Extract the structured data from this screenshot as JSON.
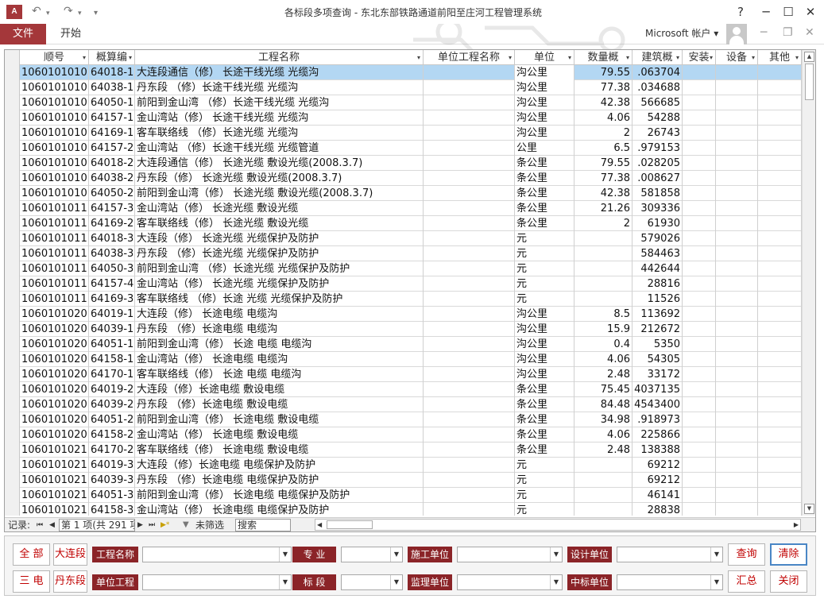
{
  "window": {
    "title": "各标段多项查询 - 东北东部铁路通道前阳至庄河工程管理系统",
    "app_icon": "A",
    "undo": "↶",
    "redo": "↷",
    "qat_more": "▾",
    "help": "?",
    "minimize": "─",
    "maximize": "☐",
    "close": "✕"
  },
  "ribbon": {
    "file_tab": "文件",
    "home_tab": "开始",
    "account": "Microsoft 帐户",
    "account_arrow": "▾",
    "min": "─",
    "restore": "❐",
    "close": "✕"
  },
  "grid": {
    "headers": [
      "顺号",
      "概算编",
      "工程名称",
      "单位工程名称",
      "单位",
      "数量概",
      "建筑概",
      "安装",
      "设备",
      "其他"
    ],
    "rows": [
      [
        "1060101010",
        "64018-1",
        "大连段通信（修） 长途干线光缆 光缆沟",
        "",
        "沟公里",
        "79.55",
        ".063704"
      ],
      [
        "1060101010",
        "64038-1",
        "丹东段 （修）长途干线光缆 光缆沟",
        "",
        "沟公里",
        "77.38",
        ".034688"
      ],
      [
        "1060101010",
        "64050-1",
        "前阳到金山湾 （修）长途干线光缆 光缆沟",
        "",
        "沟公里",
        "42.38",
        "566685"
      ],
      [
        "1060101010",
        "64157-1",
        "金山湾站（修） 长途干线光缆 光缆沟",
        "",
        "沟公里",
        "4.06",
        "54288"
      ],
      [
        "1060101010",
        "64169-1",
        "客车联络线 （修）长途光缆 光缆沟",
        "",
        "沟公里",
        "2",
        "26743"
      ],
      [
        "1060101010",
        "64157-2",
        "金山湾站 （修）长途干线光缆 光缆管道",
        "",
        "公里",
        "6.5",
        ".979153"
      ],
      [
        "1060101010",
        "64018-2",
        "大连段通信（修） 长途光缆 敷设光缆(2008.3.7)",
        "",
        "条公里",
        "79.55",
        ".028205"
      ],
      [
        "1060101010",
        "64038-2",
        "丹东段（修） 长途光缆 敷设光缆(2008.3.7)",
        "",
        "条公里",
        "77.38",
        ".008627"
      ],
      [
        "1060101010",
        "64050-2",
        "前阳到金山湾（修） 长途光缆 敷设光缆(2008.3.7)",
        "",
        "条公里",
        "42.38",
        "581858"
      ],
      [
        "1060101011",
        "64157-3",
        "金山湾站（修） 长途光缆 敷设光缆",
        "",
        "条公里",
        "21.26",
        "309336"
      ],
      [
        "1060101011",
        "64169-2",
        "客车联络线（修） 长途光缆 敷设光缆",
        "",
        "条公里",
        "2",
        "61930"
      ],
      [
        "1060101011",
        "64018-3",
        "大连段（修） 长途光缆 光缆保护及防护",
        "",
        "元",
        "",
        "579026"
      ],
      [
        "1060101011",
        "64038-3",
        "丹东段 （修）长途光缆 光缆保护及防护",
        "",
        "元",
        "",
        "584463"
      ],
      [
        "1060101011",
        "64050-3",
        "前阳到金山湾 （修）长途光缆 光缆保护及防护",
        "",
        "元",
        "",
        "442644"
      ],
      [
        "1060101011",
        "64157-4",
        "金山湾站（修） 长途光缆 光缆保护及防护",
        "",
        "元",
        "",
        "28816"
      ],
      [
        "1060101011",
        "64169-3",
        "客车联络线 （修）长途 光缆 光缆保护及防护",
        "",
        "元",
        "",
        "11526"
      ],
      [
        "1060101020",
        "64019-1",
        "大连段（修） 长途电缆 电缆沟",
        "",
        "沟公里",
        "8.5",
        "113692"
      ],
      [
        "1060101020",
        "64039-1",
        "丹东段 （修）长途电缆 电缆沟",
        "",
        "沟公里",
        "15.9",
        "212672"
      ],
      [
        "1060101020",
        "64051-1",
        "前阳到金山湾（修） 长途 电缆 电缆沟",
        "",
        "沟公里",
        "0.4",
        "5350"
      ],
      [
        "1060101020",
        "64158-1",
        "金山湾站（修） 长途电缆 电缆沟",
        "",
        "沟公里",
        "4.06",
        "54305"
      ],
      [
        "1060101020",
        "64170-1",
        "客车联络线（修） 长途 电缆 电缆沟",
        "",
        "沟公里",
        "2.48",
        "33172"
      ],
      [
        "1060101020",
        "64019-2",
        "大连段（修）长途电缆 敷设电缆",
        "",
        "条公里",
        "75.45",
        "4037135"
      ],
      [
        "1060101020",
        "64039-2",
        "丹东段 （修）长途电缆 敷设电缆",
        "",
        "条公里",
        "84.48",
        "4543400"
      ],
      [
        "1060101020",
        "64051-2",
        "前阳到金山湾（修） 长途电缆 敷设电缆",
        "",
        "条公里",
        "34.98",
        ".918973"
      ],
      [
        "1060101020",
        "64158-2",
        "金山湾站（修） 长途电缆 敷设电缆",
        "",
        "条公里",
        "4.06",
        "225866"
      ],
      [
        "1060101021",
        "64170-2",
        "客车联络线（修） 长途电缆 敷设电缆",
        "",
        "条公里",
        "2.48",
        "138388"
      ],
      [
        "1060101021",
        "64019-3",
        "大连段（修）长途电缆 电缆保护及防护",
        "",
        "元",
        "",
        "69212"
      ],
      [
        "1060101021",
        "64039-3",
        "丹东段 （修）长途电缆 电缆保护及防护",
        "",
        "元",
        "",
        "69212"
      ],
      [
        "1060101021",
        "64051-3",
        "前阳到金山湾（修） 长途电缆 电缆保护及防护",
        "",
        "元",
        "",
        "46141"
      ],
      [
        "1060101021",
        "64158-3",
        "金山湾站（修） 长途电缆 电缆保护及防护",
        "",
        "元",
        "",
        "28838"
      ]
    ]
  },
  "navbar": {
    "label": "记录:",
    "first": "⏮",
    "prev": "◀",
    "position": "第 1 项(共 291 项",
    "next": "▶",
    "last": "⏭",
    "new": "▶*",
    "filter_icon": "▼",
    "filter": "未筛选",
    "search": "搜索"
  },
  "panel": {
    "btn_all": "全 部",
    "btn_dalian": "大连段",
    "btn_sandian": "三 电",
    "btn_dandong": "丹东段",
    "lbl_name": "工程名称",
    "lbl_major": "专 业",
    "lbl_constr": "施工单位",
    "lbl_design": "设计单位",
    "lbl_unit": "单位工程",
    "lbl_section": "标 段",
    "lbl_super": "监理单位",
    "lbl_winner": "中标单位",
    "btn_query": "查询",
    "btn_clear": "清除",
    "btn_sum": "汇总",
    "btn_close": "关闭",
    "accent": "#8b2428"
  }
}
